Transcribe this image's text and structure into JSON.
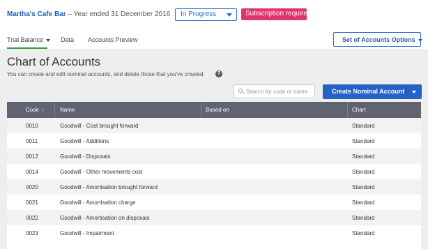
{
  "header": {
    "client_name": "Martha's Cafe Bar",
    "period": "– Year ended 31 December 2016",
    "status_value": "In Progress",
    "subscription_badge": "Subscription required"
  },
  "tabs": [
    {
      "label": "Trial Balance",
      "active": true
    },
    {
      "label": "Data",
      "active": false
    },
    {
      "label": "Accounts Preview",
      "active": false
    }
  ],
  "set_of_accounts_label": "Set of Accounts Options",
  "main": {
    "title": "Chart of Accounts",
    "subtitle": "You can create and edit nominal accounts, and delete those that you've created.",
    "search_placeholder": "Search for code or name",
    "create_label": "Create Nominal Account"
  },
  "table": {
    "columns": [
      "Code",
      "Name",
      "Based on",
      "Chart"
    ],
    "sort_indicator": "↑",
    "rows": [
      {
        "code": "0010",
        "name": "Goodwill - Cost brought forward",
        "based_on": "",
        "chart": "Standard"
      },
      {
        "code": "0011",
        "name": "Goodwill - Additions",
        "based_on": "",
        "chart": "Standard"
      },
      {
        "code": "0012",
        "name": "Goodwill - Disposals",
        "based_on": "",
        "chart": "Standard"
      },
      {
        "code": "0014",
        "name": "Goodwill - Other movements cost",
        "based_on": "",
        "chart": "Standard"
      },
      {
        "code": "0020",
        "name": "Goodwill - Amortisation brought forward",
        "based_on": "",
        "chart": "Standard"
      },
      {
        "code": "0021",
        "name": "Goodwill - Amortisation charge",
        "based_on": "",
        "chart": "Standard"
      },
      {
        "code": "0022",
        "name": "Goodwill - Amortisation on disposals",
        "based_on": "",
        "chart": "Standard"
      },
      {
        "code": "0023",
        "name": "Goodwill - Impairment",
        "based_on": "",
        "chart": "Standard"
      }
    ]
  },
  "colors": {
    "accent_blue": "#2563c9",
    "badge_pink": "#e0356a",
    "active_tab_green": "#2a9d3d",
    "table_header": "#5f6470"
  }
}
